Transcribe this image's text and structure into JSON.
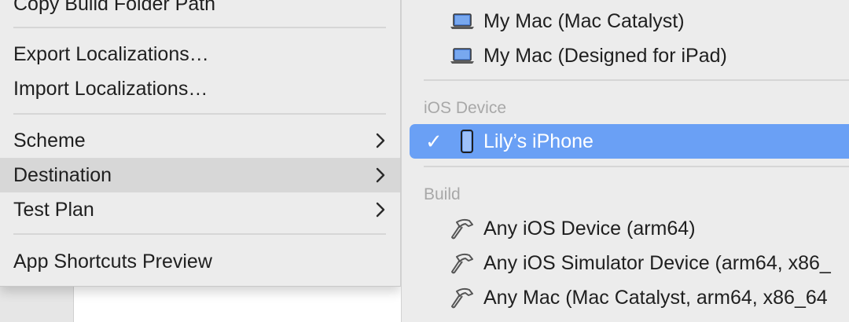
{
  "left_menu": {
    "items": [
      {
        "label": "Copy Build Folder Path"
      },
      {
        "label": "Export Localizations…"
      },
      {
        "label": "Import Localizations…"
      },
      {
        "label": "Scheme"
      },
      {
        "label": "Destination"
      },
      {
        "label": "Test Plan"
      },
      {
        "label": "App Shortcuts Preview"
      }
    ]
  },
  "destination_menu": {
    "mac_items": [
      {
        "label": "My Mac (Mac Catalyst)",
        "icon": "laptop-icon"
      },
      {
        "label": "My Mac (Designed for iPad)",
        "icon": "laptop-icon"
      }
    ],
    "ios_device_header": "iOS Device",
    "selected_device": {
      "label": "Lily’s iPhone",
      "checkmark": "✓",
      "icon": "iphone-icon"
    },
    "build_header": "Build",
    "build_items": [
      {
        "label": "Any iOS Device (arm64)",
        "icon": "hammer-icon"
      },
      {
        "label": "Any iOS Simulator Device (arm64, x86_",
        "icon": "hammer-icon"
      },
      {
        "label": "Any Mac (Mac Catalyst, arm64, x86_64",
        "icon": "hammer-icon"
      }
    ],
    "highlight_color": "#6aa0f5"
  }
}
